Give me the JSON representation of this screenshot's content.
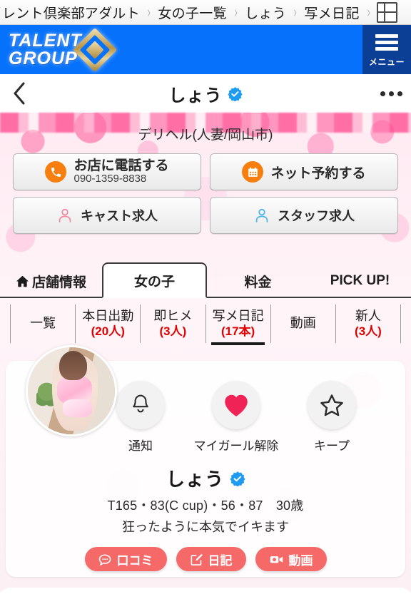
{
  "breadcrumb": {
    "items": [
      "レント倶楽部アダルト",
      "女の子一覧",
      "しょう",
      "写メ日記"
    ],
    "separator": "›",
    "grid_icon": "grid-table-icon"
  },
  "brand": {
    "logo_line1": "TALENT",
    "logo_line2": "GROUP",
    "emblem_icon": "diamond-emblem-icon",
    "menu_label": "メニュー",
    "menu_icon": "hamburger-icon",
    "header_color": "#0671fb",
    "menu_color": "#0b3f96"
  },
  "titlebar": {
    "back_icon": "chevron-left-icon",
    "title": "しょう",
    "verified_icon": "verified-badge-icon",
    "verified_color": "#1d9bf0",
    "more_icon": "more-horizontal-icon"
  },
  "shop": {
    "category": "デリヘル(人妻/岡山市)",
    "actions": [
      {
        "id": "call",
        "icon": "phone-icon",
        "label": "お店に電話する",
        "sub": "090-1359-8838",
        "icon_color": "#f77f10"
      },
      {
        "id": "reserve",
        "icon": "calendar-icon",
        "label": "ネット予約する",
        "sub": "",
        "icon_color": "#f77f10"
      },
      {
        "id": "cast-recruit",
        "icon": "person-pink-icon",
        "label": "キャスト求人",
        "sub": "",
        "icon_color": "#f08ca4"
      },
      {
        "id": "staff-recruit",
        "icon": "person-blue-icon",
        "label": "スタッフ求人",
        "sub": "",
        "icon_color": "#55b6e8"
      }
    ]
  },
  "main_tabs": [
    {
      "id": "shop-info",
      "label": "店舗情報",
      "icon": "home-icon",
      "active": false
    },
    {
      "id": "girls",
      "label": "女の子",
      "icon": "",
      "active": true
    },
    {
      "id": "price",
      "label": "料金",
      "icon": "",
      "active": false
    },
    {
      "id": "pickup",
      "label": "PICK UP!",
      "icon": "",
      "active": false
    }
  ],
  "sub_tabs": [
    {
      "id": "list",
      "label": "一覧",
      "count": "",
      "active": false
    },
    {
      "id": "today",
      "label": "本日出勤",
      "count": "(20人)",
      "active": false
    },
    {
      "id": "soku-hime",
      "label": "即ヒメ",
      "count": "(3人)",
      "active": false
    },
    {
      "id": "shame-nikki",
      "label": "写メ日記",
      "count": "(17本)",
      "active": true
    },
    {
      "id": "movie",
      "label": "動画",
      "count": "",
      "active": false
    },
    {
      "id": "newface",
      "label": "新人",
      "count": "(3人)",
      "active": false
    }
  ],
  "profile": {
    "avatar_alt": "girl-photo",
    "name": "しょう",
    "verified_icon": "verified-badge-icon",
    "stats": "T165・83(C cup)・56・87　30歳",
    "catchphrase": "狂ったように本気でイキます",
    "actions": [
      {
        "id": "notify",
        "icon": "bell-icon",
        "label": "通知",
        "active": false
      },
      {
        "id": "mygirl",
        "icon": "heart-icon",
        "label": "マイガール解除",
        "active": true,
        "color": "#f02356"
      },
      {
        "id": "keep",
        "icon": "star-icon",
        "label": "キープ",
        "active": false
      }
    ],
    "pills": [
      {
        "id": "reviews",
        "icon": "speech-bubble-icon",
        "label": "口コミ"
      },
      {
        "id": "diary",
        "icon": "pencil-note-icon",
        "label": "日記"
      },
      {
        "id": "movie",
        "icon": "video-camera-icon",
        "label": "動画"
      }
    ],
    "pill_color": "#f56a68"
  }
}
